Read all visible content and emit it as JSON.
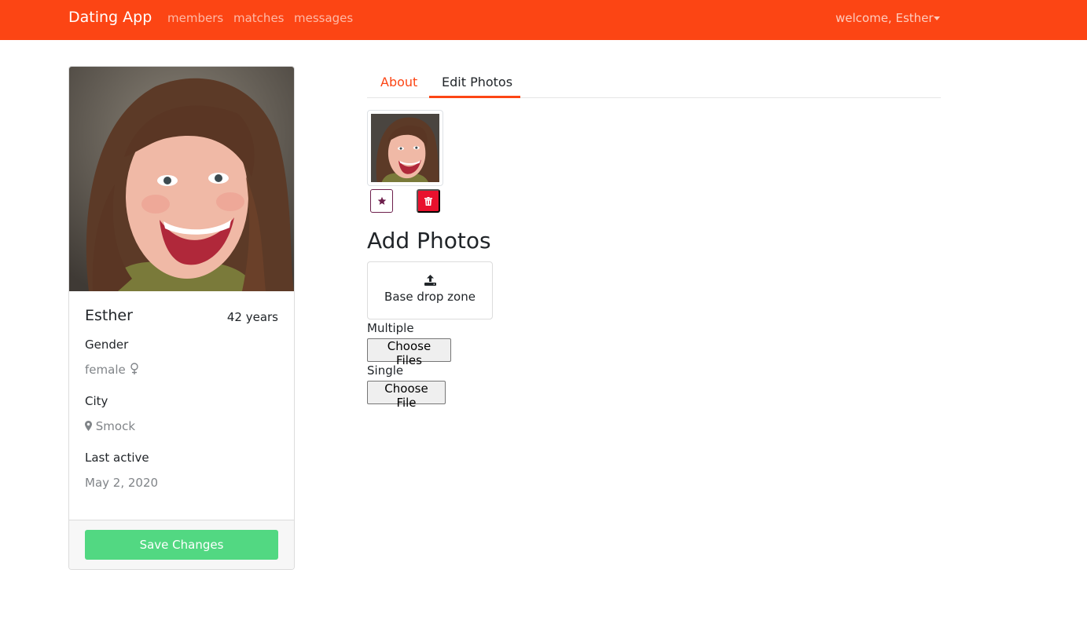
{
  "nav": {
    "brand": "Dating App",
    "links": [
      "members",
      "matches",
      "messages"
    ],
    "welcome": "welcome, Esther",
    "bg_color": "#fc4514"
  },
  "profile": {
    "name": "Esther",
    "age": "42 years",
    "gender_label": "Gender",
    "gender_value": "female",
    "city_label": "City",
    "city_value": "Smock",
    "last_active_label": "Last active",
    "last_active_value": "May 2, 2020",
    "save_button": "Save Changes",
    "save_color": "#52d882"
  },
  "tabs": [
    {
      "label": "About",
      "active": false
    },
    {
      "label": "Edit Photos",
      "active": true
    }
  ],
  "photos": {
    "set_main_icon": "star-icon",
    "delete_icon": "trash-icon",
    "delete_color": "#e8112d"
  },
  "uploader": {
    "title": "Add Photos",
    "dropzone_icon": "upload-icon",
    "dropzone_text": "Base drop zone",
    "multiple_label": "Multiple",
    "multiple_button": "Choose Files",
    "single_label": "Single",
    "single_button": "Choose File"
  }
}
